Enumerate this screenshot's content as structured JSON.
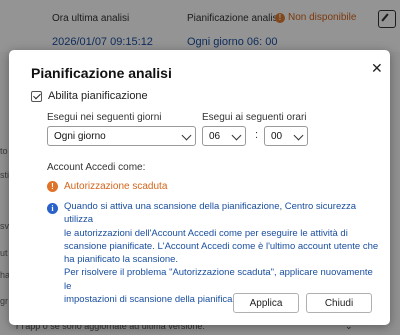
{
  "background": {
    "last_analysis_label": "Ora ultima analisi",
    "last_analysis_value": "2026/01/07 09:15:12",
    "schedule_label": "Pianificazione analisi",
    "schedule_status": "Non disponibile",
    "schedule_value": "Ogni giorno 06: 00",
    "side_fragments": [
      "to",
      "sti",
      "sv",
      "ut",
      "ha",
      "gr"
    ],
    "footer_text": "r l'app o se sono aggiornate ad ultima versione.",
    "status_color": "#d4641a"
  },
  "dialog": {
    "title": "Pianificazione analisi",
    "close_icon": "close-icon",
    "enable_label": "Abilita pianificazione",
    "enable_checked": true,
    "days_label": "Esegui nei seguenti giorni",
    "days_value": "Ogni giorno",
    "times_label": "Esegui ai seguenti orari",
    "hour_value": "06",
    "minute_value": "00",
    "time_separator": ":",
    "account_label": "Account Accedi come:",
    "warning_text": "Autorizzazione scaduta",
    "info_lines": [
      "Quando si attiva una scansione della pianificazione, Centro sicurezza utilizza",
      "le autorizzazioni dell'Account Accedi come per eseguire le attività di",
      "scansione pianificate. L'Account Accedi come è l'ultimo account utente che",
      "ha pianificato la scansione.",
      "Per risolvere il problema \"Autorizzazione scaduta\", applicare nuovamente le",
      "impostazioni di scansione della pianificazione."
    ],
    "apply_label": "Applica",
    "close_label": "Chiudi",
    "info_color": "#1a4fa0",
    "warning_color": "#d4641a"
  }
}
